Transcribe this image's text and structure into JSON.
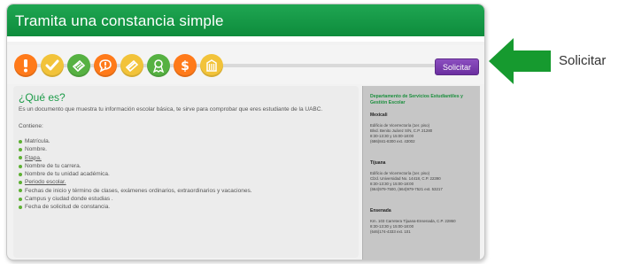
{
  "header": {
    "title": "Tramita una constancia simple"
  },
  "steps": [
    {
      "icon": "exclamation-icon",
      "color": "#ff7a1a"
    },
    {
      "icon": "check-icon",
      "color": "#f2c33a"
    },
    {
      "icon": "papers-icon",
      "color": "#56b142"
    },
    {
      "icon": "alert-chat-icon",
      "color": "#ff7a1a"
    },
    {
      "icon": "card-swipe-icon",
      "color": "#f2c33a"
    },
    {
      "icon": "ribbon-icon",
      "color": "#56b142"
    },
    {
      "icon": "dollar-icon",
      "color": "#ff7a1a"
    },
    {
      "icon": "building-icon",
      "color": "#f2c33a"
    }
  ],
  "solicitar_button": "Solicitar",
  "annotation_label": "Solicitar",
  "accent_colors": {
    "green": "#1fa652",
    "purple": "#6b2fa0",
    "arrow": "#169a2f"
  },
  "main": {
    "title": "¿Qué es?",
    "intro": "Es un documento que muestra tu información escolar básica, te sirve para comprobar que eres estudiante de la UABC.",
    "contiene": "Contiene:",
    "items": [
      "Matrícula.",
      "Nombre.",
      "Etapa.",
      "Nombre de tu carrera.",
      "Nombre de tu unidad académica.",
      "Periodo escolar.",
      "Fechas de inicio y término de clases, exámenes ordinarios, extraordinarios y vacaciones.",
      "Campus y ciudad donde estudias .",
      "Fecha de solicitud de constancia."
    ]
  },
  "sidebar": {
    "title": "Departamento de Servicios Estudiantiles y Gestión Escolar",
    "campuses": [
      {
        "name": "Mexicali",
        "lines": [
          "Edificio de Vicerrectoría (1er. piso)",
          "Blvd. Benito Juárez S/N, C.P. 21280",
          "8:30-13:30 y 15:00-18:00",
          "(686)841-8300 ext. 43002"
        ]
      },
      {
        "name": "Tijuana",
        "lines": [
          "Edificio de Vicerrectoría (1er. piso)",
          "Clzd. Universidad No. 14418, C.P. 22390",
          "8:30-13:30 y 15:00-18:00",
          "(664)979-7500, (664)979-7521 ext. 53217"
        ]
      },
      {
        "name": "Ensenada",
        "lines": [
          "Km. 103 Carretera Tijuana-Ensenada, C.P. 22860",
          "8:30-13:30 y 15:00-18:00",
          "(646)174-4333 ext. 101"
        ]
      }
    ]
  }
}
